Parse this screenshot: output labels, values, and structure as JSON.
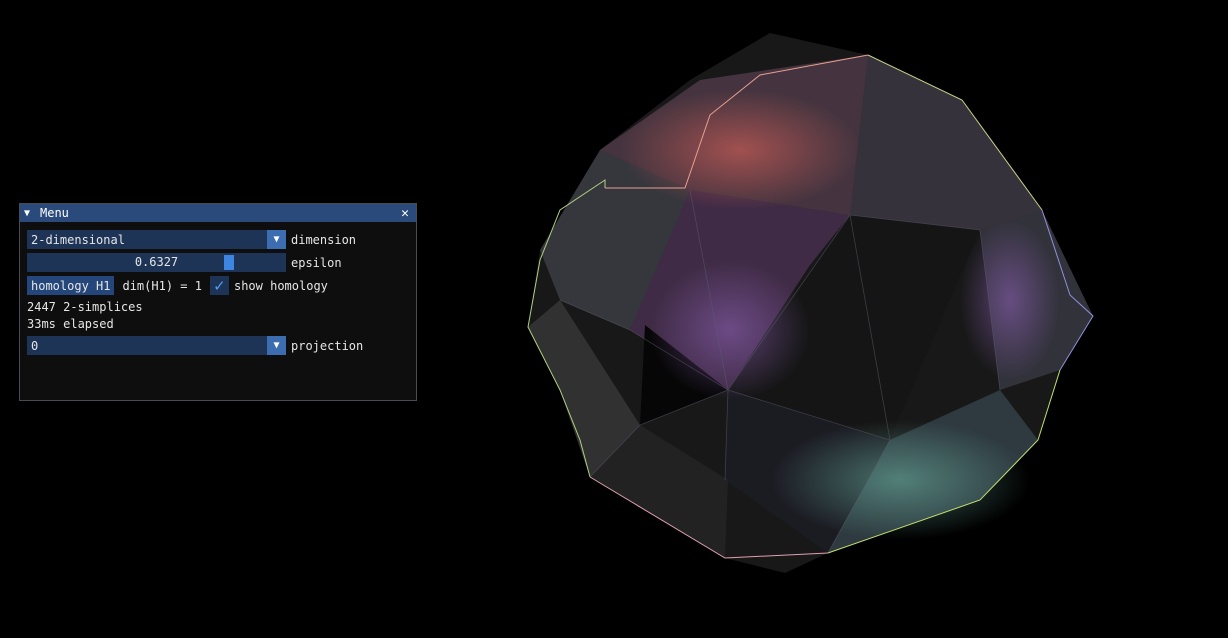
{
  "window": {
    "title": "Menu",
    "collapse_icon": "▼",
    "close_icon": "✕"
  },
  "dimension": {
    "value": "2-dimensional",
    "label": "dimension"
  },
  "epsilon": {
    "value": "0.6327",
    "label": "epsilon",
    "fraction": 0.79
  },
  "homology": {
    "button_label": "homology H1",
    "dim_text": "dim(H1) = 1",
    "show_checked": true,
    "show_label": "show homology"
  },
  "stats": {
    "simplices": "2447 2-simplices",
    "elapsed": "33ms elapsed"
  },
  "projection": {
    "value": "0",
    "label": "projection"
  },
  "colors": {
    "background": "#000000",
    "title_bar": "#294a7a",
    "frame": "#1d3457",
    "accent": "#3d85e0",
    "button": "#24467a"
  }
}
